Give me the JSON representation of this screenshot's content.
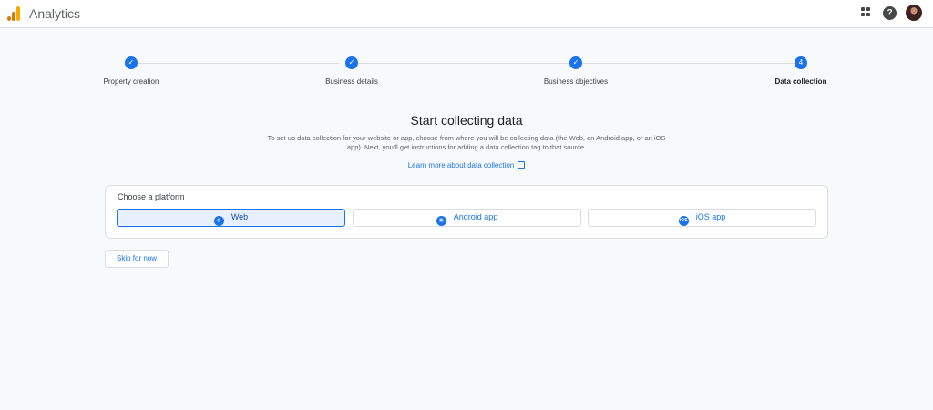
{
  "app": {
    "title": "Analytics"
  },
  "topbar": {
    "apps_icon": "apps-grid-icon",
    "help_icon": "help-icon",
    "help_glyph": "?",
    "avatar": "user-avatar"
  },
  "stepper": {
    "steps": [
      {
        "label": "Property creation",
        "status": "complete",
        "marker": "✓"
      },
      {
        "label": "Business details",
        "status": "complete",
        "marker": "✓"
      },
      {
        "label": "Business objectives",
        "status": "complete",
        "marker": "✓"
      },
      {
        "label": "Data collection",
        "status": "current",
        "marker": "4"
      }
    ]
  },
  "main": {
    "title": "Start collecting data",
    "description": "To set up data collection for your website or app, choose from where you will be collecting data (the Web, an Android app, or an iOS app). Next, you’ll get instructions for adding a data collection tag to that source.",
    "learn_more": "Learn more about data collection"
  },
  "platform_card": {
    "title": "Choose a platform",
    "options": [
      {
        "label": "Web",
        "icon": "globe-icon",
        "glyph": "◍",
        "selected": true
      },
      {
        "label": "Android app",
        "icon": "android-icon",
        "glyph": "▣",
        "selected": false
      },
      {
        "label": "iOS app",
        "icon": "ios-icon",
        "glyph": "iOS",
        "selected": false
      }
    ]
  },
  "skip_label": "Skip for now",
  "colors": {
    "accent": "#1a73e8",
    "selected_bg": "#e8f0fe",
    "logo_orange": "#e37400",
    "logo_yellow": "#f9ab00"
  }
}
